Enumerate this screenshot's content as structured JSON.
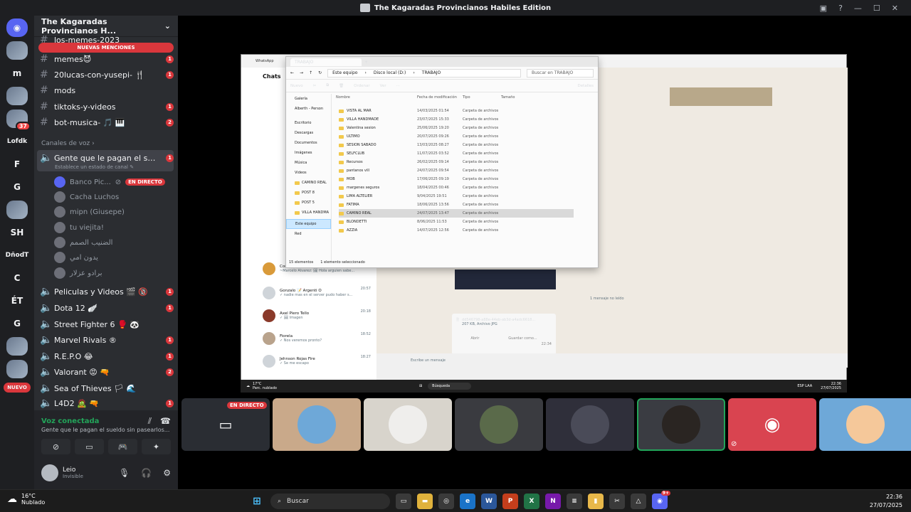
{
  "window": {
    "title": "The Kagaradas Provincianos Habiles Edition"
  },
  "servers": [
    {
      "label": "m",
      "badge": ""
    },
    {
      "label": "",
      "badge": "37"
    },
    {
      "label": "Lofdk",
      "badge": ""
    },
    {
      "label": "F",
      "badge": ""
    },
    {
      "label": "G",
      "badge": ""
    },
    {
      "label": "SH",
      "badge": ""
    },
    {
      "label": "DñodT",
      "badge": ""
    },
    {
      "label": "C",
      "badge": ""
    },
    {
      "label": "ÉT",
      "badge": ""
    },
    {
      "label": "G",
      "badge": ""
    },
    {
      "label": "NUEVO",
      "badge": ""
    }
  ],
  "guild": {
    "name": "The Kagaradas Provincianos H...",
    "new_mentions": "NUEVAS MENCIONES",
    "top_partial": "los-memes-2023"
  },
  "text_channels": [
    {
      "name": "memes😈",
      "count": "1"
    },
    {
      "name": "20lucas-con-yusepi- 🍴",
      "count": "1"
    },
    {
      "name": "mods",
      "count": ""
    },
    {
      "name": "tiktoks-y-videos",
      "count": "1"
    },
    {
      "name": "bot-musica- 🎵 🎹",
      "count": "2"
    }
  ],
  "voice_category": "Canales de voz",
  "active_voice": {
    "name": "Gente que le pagan el sueld...",
    "status": "Establece un estado de canal ✎",
    "count": "1"
  },
  "voice_users": [
    {
      "name": "Banco Pic...",
      "live": "EN DIRECTO"
    },
    {
      "name": "Cacha Luchos",
      "live": ""
    },
    {
      "name": "mipn (Giusepe)",
      "live": ""
    },
    {
      "name": "tu viejita!",
      "live": ""
    },
    {
      "name": "الضنيب الصمم",
      "live": ""
    },
    {
      "name": "يدون امي",
      "live": ""
    },
    {
      "name": "برادو عزلار",
      "live": ""
    }
  ],
  "voice_channels": [
    {
      "name": "Peliculas y Videos 🎬 🔞",
      "count": "1"
    },
    {
      "name": "Dota 12 🪽",
      "count": "1"
    },
    {
      "name": "Street Fighter 6 🥊 🐼",
      "count": ""
    },
    {
      "name": "Marvel Rivals ®",
      "count": "1"
    },
    {
      "name": "R.E.P.O 😂",
      "count": "1"
    },
    {
      "name": "Valorant 😡 🔫",
      "count": "2"
    },
    {
      "name": "Sea of Thieves 🏳 🌊",
      "count": ""
    },
    {
      "name": "L4D2 🧟 🔫",
      "count": "1"
    }
  ],
  "voice_connected": {
    "title": "Voz conectada",
    "channel": "Gente que le pagan el sueldo sin pasearlos..."
  },
  "user": {
    "name": "Leio",
    "status": "Invisible"
  },
  "whatsapp": {
    "app": "WhatsApp",
    "heading": "Chats",
    "chats": [
      {
        "name": "Gonzalo 📝 Argenti O",
        "msg": "✓ nadie mas en el server pudo haber s...",
        "time": "20:57"
      },
      {
        "name": "Axel Piero Tello",
        "msg": "✓ 🖼 Imagen",
        "time": "20:18"
      },
      {
        "name": "Fiorela",
        "msg": "✓ Nos veremos pronto?",
        "time": "18:52"
      },
      {
        "name": "Jehnson Rojas Fire",
        "msg": "✓ Se me escapo",
        "time": "18:27"
      }
    ],
    "partial_chat": {
      "name": "Comunia Gtma 2020/1",
      "msg": "~Marcelo Alvarez: 🖼 Hola arguien sabe..."
    },
    "note": "1 mensaje no leído",
    "file": {
      "name": "dd546798-a88e-44eb-ab3d-a4adc6618...",
      "meta": "207 KB, Archivo JPG",
      "open": "Abrir",
      "save": "Guardar como...",
      "time": "22:34"
    },
    "compose": "Escribe un mensaje"
  },
  "explorer": {
    "tab": "TRABAJO",
    "path": [
      "Este equipo",
      "Disco local (D:)",
      "TRABAJO"
    ],
    "search": "Buscar en TRABAJO",
    "toolbar": [
      "Nuevo",
      "Ordenar",
      "Ver",
      "Detalles"
    ],
    "nav": [
      "Galería",
      "Alberth - Person",
      "Escritorio",
      "Descargas",
      "Documentos",
      "Imágenes",
      "Música",
      "Videos",
      "CAMINO REAL",
      "POST 8",
      "POST 5",
      "VILLA HANDMA",
      "Este equipo",
      "Red"
    ],
    "columns": [
      "Nombre",
      "Fecha de modificación",
      "Tipo",
      "Tamaño"
    ],
    "rows": [
      {
        "name": "VISTA AL MAR",
        "date": "14/03/2025 01:54",
        "type": "Carpeta de archivos"
      },
      {
        "name": "VILLA HANDMADE",
        "date": "23/07/2025 15:33",
        "type": "Carpeta de archivos"
      },
      {
        "name": "Valentina sesion",
        "date": "25/06/2025 19:20",
        "type": "Carpeta de archivos"
      },
      {
        "name": "ULTIMO",
        "date": "20/07/2025 09:26",
        "type": "Carpeta de archivos"
      },
      {
        "name": "SESION SABADO",
        "date": "13/03/2025 08:27",
        "type": "Carpeta de archivos"
      },
      {
        "name": "SELFCLUB",
        "date": "11/07/2025 03:52",
        "type": "Carpeta de archivos"
      },
      {
        "name": "Recursos",
        "date": "26/02/2025 09:14",
        "type": "Carpeta de archivos"
      },
      {
        "name": "pantanos vill",
        "date": "24/07/2025 09:54",
        "type": "Carpeta de archivos"
      },
      {
        "name": "MOB",
        "date": "17/06/2025 09:19",
        "type": "Carpeta de archivos"
      },
      {
        "name": "margenes seguros",
        "date": "18/04/2025 00:46",
        "type": "Carpeta de archivos"
      },
      {
        "name": "LIMA ALTELIER",
        "date": "9/04/2025 19:51",
        "type": "Carpeta de archivos"
      },
      {
        "name": "FATIMA",
        "date": "18/06/2025 13:56",
        "type": "Carpeta de archivos"
      },
      {
        "name": "CAMINO REAL",
        "date": "24/07/2025 13:47",
        "type": "Carpeta de archivos"
      },
      {
        "name": "BLONDETTI",
        "date": "8/06/2025 11:53",
        "type": "Carpeta de archivos"
      },
      {
        "name": "AZZIA",
        "date": "14/07/2025 12:56",
        "type": "Carpeta de archivos"
      }
    ],
    "status": [
      "15 elementos",
      "1 elemento seleccionado"
    ]
  },
  "stream_taskbar": {
    "weather": "17°C",
    "weather_sub": "Parc. nublado",
    "search": "Búsqueda",
    "lang": "ESP LAA",
    "time": "22:36",
    "date": "27/07/2025"
  },
  "tiles": [
    {
      "live": "EN DIRECTO",
      "color": "#2a2d33"
    },
    {
      "live": "",
      "color": "#c9a98a"
    },
    {
      "live": "",
      "color": "#d8d4cc"
    },
    {
      "live": "",
      "color": "#3a3b40"
    },
    {
      "live": "",
      "color": "#2f2f3a"
    },
    {
      "live": "",
      "color": "#3a3c42"
    },
    {
      "live": "",
      "color": "#d94450"
    },
    {
      "live": "",
      "color": "#6ea8d8"
    }
  ],
  "taskbar": {
    "weather": "16°C",
    "weather_sub": "Nublado",
    "search": "Buscar",
    "time": "22:36",
    "date": "27/07/2025",
    "discord_badge": "9+"
  },
  "colors": {
    "accent_red": "#da373c",
    "green": "#23a55a",
    "bg": "#1e1f22"
  }
}
